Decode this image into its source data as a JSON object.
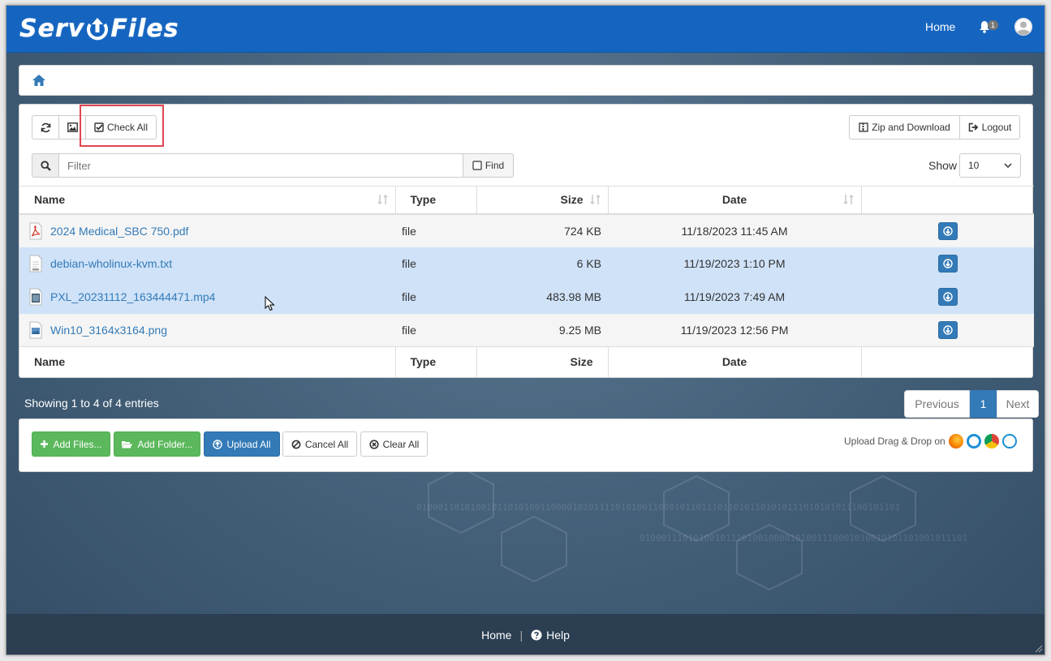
{
  "brand": {
    "text_left": "Serv",
    "text_right": "Files"
  },
  "topnav": {
    "home": "Home",
    "notif_count": "1"
  },
  "toolbar": {
    "check_all": "Check All",
    "zip_download": "Zip and Download",
    "logout": "Logout"
  },
  "filter": {
    "placeholder": "Filter",
    "find": "Find"
  },
  "show": {
    "label": "Show",
    "value": "10"
  },
  "table": {
    "headers": {
      "name": "Name",
      "type": "Type",
      "size": "Size",
      "date": "Date"
    },
    "rows": [
      {
        "name": "2024 Medical_SBC 750.pdf",
        "type": "file",
        "size": "724 KB",
        "date": "11/18/2023 11:45 AM",
        "icon": "pdf-file-icon",
        "selected": false
      },
      {
        "name": "debian-wholinux-kvm.txt",
        "type": "file",
        "size": "6 KB",
        "date": "11/19/2023 1:10 PM",
        "icon": "text-file-icon",
        "selected": true
      },
      {
        "name": "PXL_20231112_163444471.mp4",
        "type": "file",
        "size": "483.98 MB",
        "date": "11/19/2023 7:49 AM",
        "icon": "video-file-icon",
        "selected": true
      },
      {
        "name": "Win10_3164x3164.png",
        "type": "file",
        "size": "9.25 MB",
        "date": "11/19/2023 12:56 PM",
        "icon": "image-file-icon",
        "selected": false
      }
    ]
  },
  "info": {
    "showing": "Showing 1 to 4 of 4 entries"
  },
  "pager": {
    "prev": "Previous",
    "page": "1",
    "next": "Next"
  },
  "upload": {
    "add_files": "Add Files...",
    "add_folder": "Add Folder...",
    "upload_all": "Upload All",
    "cancel_all": "Cancel All",
    "clear_all": "Clear All",
    "drag_drop": "Upload Drag & Drop on"
  },
  "footer": {
    "home": "Home",
    "separator": "|",
    "help": "Help"
  },
  "colors": {
    "topbar": "#1565c0",
    "accent": "#337ab7",
    "success": "#5cb85c",
    "selected_row": "#cfe2f8",
    "highlight_box": "#e0464f"
  }
}
